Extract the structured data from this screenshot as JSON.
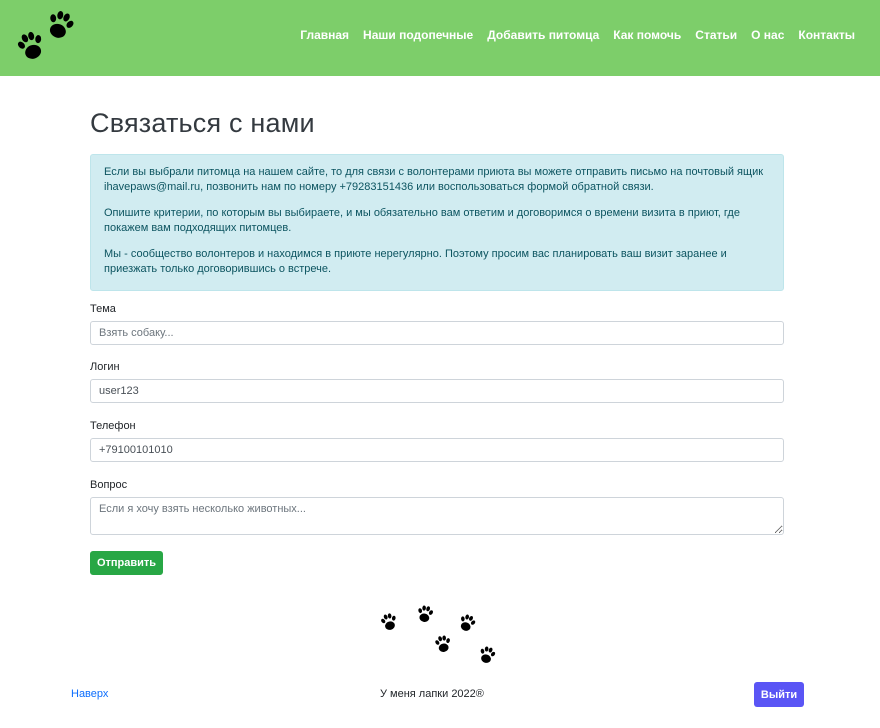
{
  "nav": {
    "items": [
      {
        "label": "Главная"
      },
      {
        "label": "Наши подопечные"
      },
      {
        "label": "Добавить питомца"
      },
      {
        "label": "Как помочь"
      },
      {
        "label": "Статьи"
      },
      {
        "label": "О нас"
      },
      {
        "label": "Контакты"
      }
    ]
  },
  "page": {
    "title": "Связаться с нами"
  },
  "info": {
    "paragraphs": [
      "Если вы выбрали питомца на нашем сайте, то для связи с волонтерами приюта вы можете отправить письмо на почтовый ящик ihavepaws@mail.ru, позвонить нам по номеру +79283151436 или воспользоваться формой обратной связи.",
      "Опишите критерии, по которым вы выбираете, и мы обязательно вам ответим и договоримся о времени визита в приют, где покажем вам подходящих питомцев.",
      "Мы - сообщество волонтеров и находимся в приюте нерегулярно. Поэтому просим вас планировать ваш визит заранее и приезжать только договорившись о встрече."
    ]
  },
  "form": {
    "subject": {
      "label": "Тема",
      "placeholder": "Взять собаку..."
    },
    "login": {
      "label": "Логин",
      "value": "user123"
    },
    "phone": {
      "label": "Телефон",
      "value": "+79100101010"
    },
    "question": {
      "label": "Вопрос",
      "placeholder": "Если я хочу взять несколько животных..."
    },
    "submit_label": "Отправить"
  },
  "footer": {
    "top_link": "Наверх",
    "copyright": "У меня лапки 2022®",
    "logout_label": "Выйти"
  },
  "icons": {
    "logo": "paw-prints-icon",
    "decor": "paw-trail-icon"
  },
  "colors": {
    "navbar": "#7dce6a",
    "info_bg": "#d1ecf1",
    "info_text": "#0c5460",
    "submit": "#28a745",
    "logout": "#5a55f5",
    "link": "#0d6efd"
  }
}
